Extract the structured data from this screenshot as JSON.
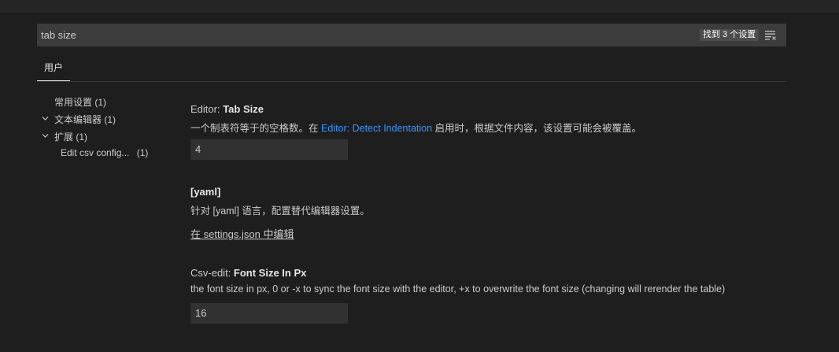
{
  "search": {
    "value": "tab size",
    "result_count": "找到 3 个设置"
  },
  "tabs": [
    {
      "label": "用户"
    }
  ],
  "toc": {
    "items": [
      {
        "label": "常用设置",
        "count": "(1)"
      },
      {
        "label": "文本编辑器",
        "count": "(1)"
      },
      {
        "label": "扩展",
        "count": "(1)"
      },
      {
        "label": "Edit csv config...",
        "count": "(1)"
      }
    ]
  },
  "settings": {
    "tab_size": {
      "category": "Editor:",
      "name": "Tab Size",
      "desc_before": "一个制表符等于的空格数。在",
      "desc_link": "Editor: Detect Indentation",
      "desc_after": "启用时，根据文件内容，该设置可能会被覆盖。",
      "value": "4"
    },
    "yaml": {
      "title": "[yaml]",
      "desc": "针对 [yaml] 语言，配置替代编辑器设置。",
      "edit_link": "在 settings.json 中编辑"
    },
    "csv_font": {
      "category": "Csv-edit:",
      "name": "Font Size In Px",
      "desc": "the font size in px, 0 or -x to sync the font size with the editor, +x to overwrite the font size (changing will rerender the table)",
      "value": "16"
    }
  }
}
